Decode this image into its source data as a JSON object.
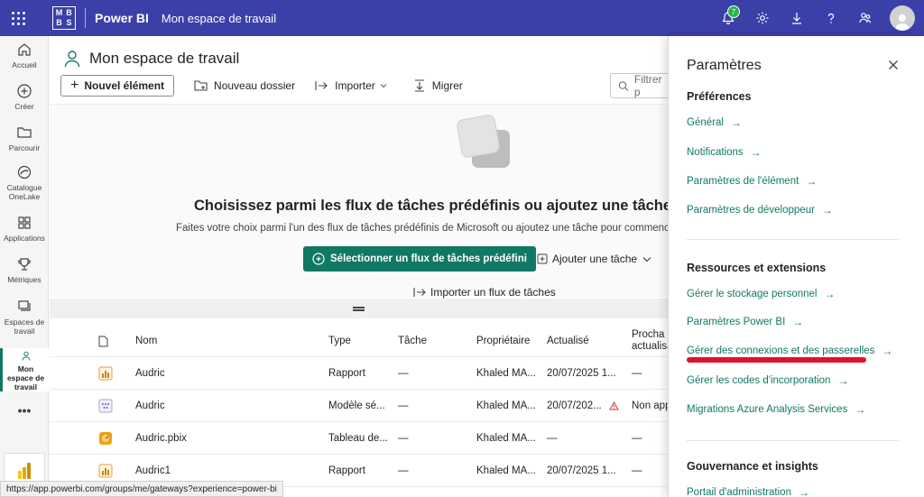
{
  "topbar": {
    "logo_letters": [
      "M",
      "B",
      "B",
      "S"
    ],
    "brand": "Power BI",
    "workspace_title": "Mon espace de travail",
    "notifications_count": "7",
    "accent_color": "#3b3fa8"
  },
  "rail": {
    "items": [
      {
        "label": "Accueil",
        "icon": "home-icon"
      },
      {
        "label": "Créer",
        "icon": "create-icon"
      },
      {
        "label": "Parcourir",
        "icon": "folder-icon"
      },
      {
        "label": "Catalogue OneLake",
        "icon": "onelake-icon"
      },
      {
        "label": "Applications",
        "icon": "apps-icon"
      },
      {
        "label": "Métriques",
        "icon": "trophy-icon"
      },
      {
        "label": "Espaces de travail",
        "icon": "workspaces-icon"
      },
      {
        "label": "Mon espace de travail",
        "icon": "person-icon"
      }
    ],
    "more": "•••"
  },
  "main": {
    "page_title": "Mon espace de travail",
    "toolbar": {
      "new_item": "Nouvel élément",
      "new_folder": "Nouveau dossier",
      "import": "Importer",
      "migrate": "Migrer",
      "filter_placeholder": "Filtrer p"
    },
    "empty_state": {
      "title": "Choisissez parmi les flux de tâches prédéfinis ou ajoutez une tâche pour",
      "subtitle": "Faites votre choix parmi l'un des flux de tâches prédéfinis de Microsoft ou ajoutez une tâche pour commencer",
      "primary_button": "Sélectionner un flux de tâches prédéfini",
      "add_task": "Ajouter une tâche",
      "import_flow": "Importer un flux de tâches"
    },
    "table": {
      "headers": {
        "name": "Nom",
        "type": "Type",
        "task": "Tâche",
        "owner": "Propriétaire",
        "updated": "Actualisé",
        "next_line1": "Procha",
        "next_line2": "actualisa"
      },
      "rows": [
        {
          "icon": "report-icon",
          "name": "Audric",
          "type": "Rapport",
          "task": "—",
          "owner": "Khaled MA...",
          "updated": "20/07/2025 1...",
          "next": "—"
        },
        {
          "icon": "semantic-model-icon",
          "name": "Audric",
          "type": "Modèle sé...",
          "task": "—",
          "owner": "Khaled MA...",
          "updated": "20/07/202...",
          "next": "Non app"
        },
        {
          "icon": "dashboard-icon",
          "name": "Audric.pbix",
          "type": "Tableau de...",
          "task": "—",
          "owner": "Khaled MA...",
          "updated": "—",
          "next": "—"
        },
        {
          "icon": "report-icon",
          "name": "Audric1",
          "type": "Rapport",
          "task": "—",
          "owner": "Khaled MA...",
          "updated": "20/07/2025 1...",
          "next": "—"
        }
      ]
    }
  },
  "panel": {
    "title": "Paramètres",
    "sections": {
      "preferences": "Préférences",
      "resources": "Ressources et extensions",
      "governance": "Gouvernance et insights"
    },
    "links": {
      "general": "Général",
      "notifications": "Notifications",
      "item_settings": "Paramètres de l'élément",
      "developer": "Paramètres de développeur",
      "storage": "Gérer le stockage personnel",
      "powerbi_settings": "Paramètres Power BI",
      "gateways": "Gérer des connexions et des passerelles",
      "embed_codes": "Gérer les codes d'incorporation",
      "azure_migrations": "Migrations Azure Analysis Services",
      "admin_portal": "Portail d'administration"
    },
    "arrow": "→",
    "link_color": "#117865"
  },
  "statusbar": {
    "url": "https://app.powerbi.com/groups/me/gateways?experience=power-bi"
  }
}
